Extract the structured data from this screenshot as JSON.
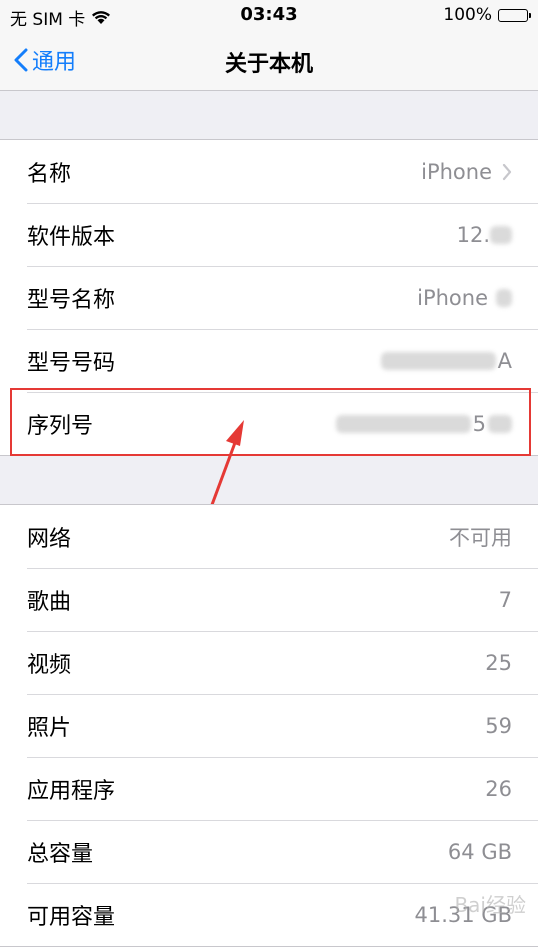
{
  "status_bar": {
    "carrier": "无 SIM 卡",
    "time": "03:43",
    "battery_percent": "100%",
    "battery_level": 1.0
  },
  "nav": {
    "back_label": "通用",
    "title": "关于本机"
  },
  "groups": [
    {
      "rows": [
        {
          "label": "名称",
          "value": "iPhone",
          "chevron": true
        },
        {
          "label": "软件版本",
          "value": "12.",
          "redacted": true
        },
        {
          "label": "型号名称",
          "value": "iPhone",
          "redacted": true
        },
        {
          "label": "型号号码",
          "value": "A",
          "redacted": true
        },
        {
          "label": "序列号",
          "value": "5",
          "redacted": true
        }
      ]
    },
    {
      "rows": [
        {
          "label": "网络",
          "value": "不可用"
        },
        {
          "label": "歌曲",
          "value": "7"
        },
        {
          "label": "视频",
          "value": "25"
        },
        {
          "label": "照片",
          "value": "59"
        },
        {
          "label": "应用程序",
          "value": "26"
        },
        {
          "label": "总容量",
          "value": "64 GB"
        },
        {
          "label": "可用容量",
          "value": "41.31 GB"
        }
      ]
    }
  ],
  "colors": {
    "accent": "#147efb",
    "highlight": "#e53935",
    "secondary_text": "#8e8e93",
    "background": "#efeff4"
  },
  "watermark": "Bai经验"
}
